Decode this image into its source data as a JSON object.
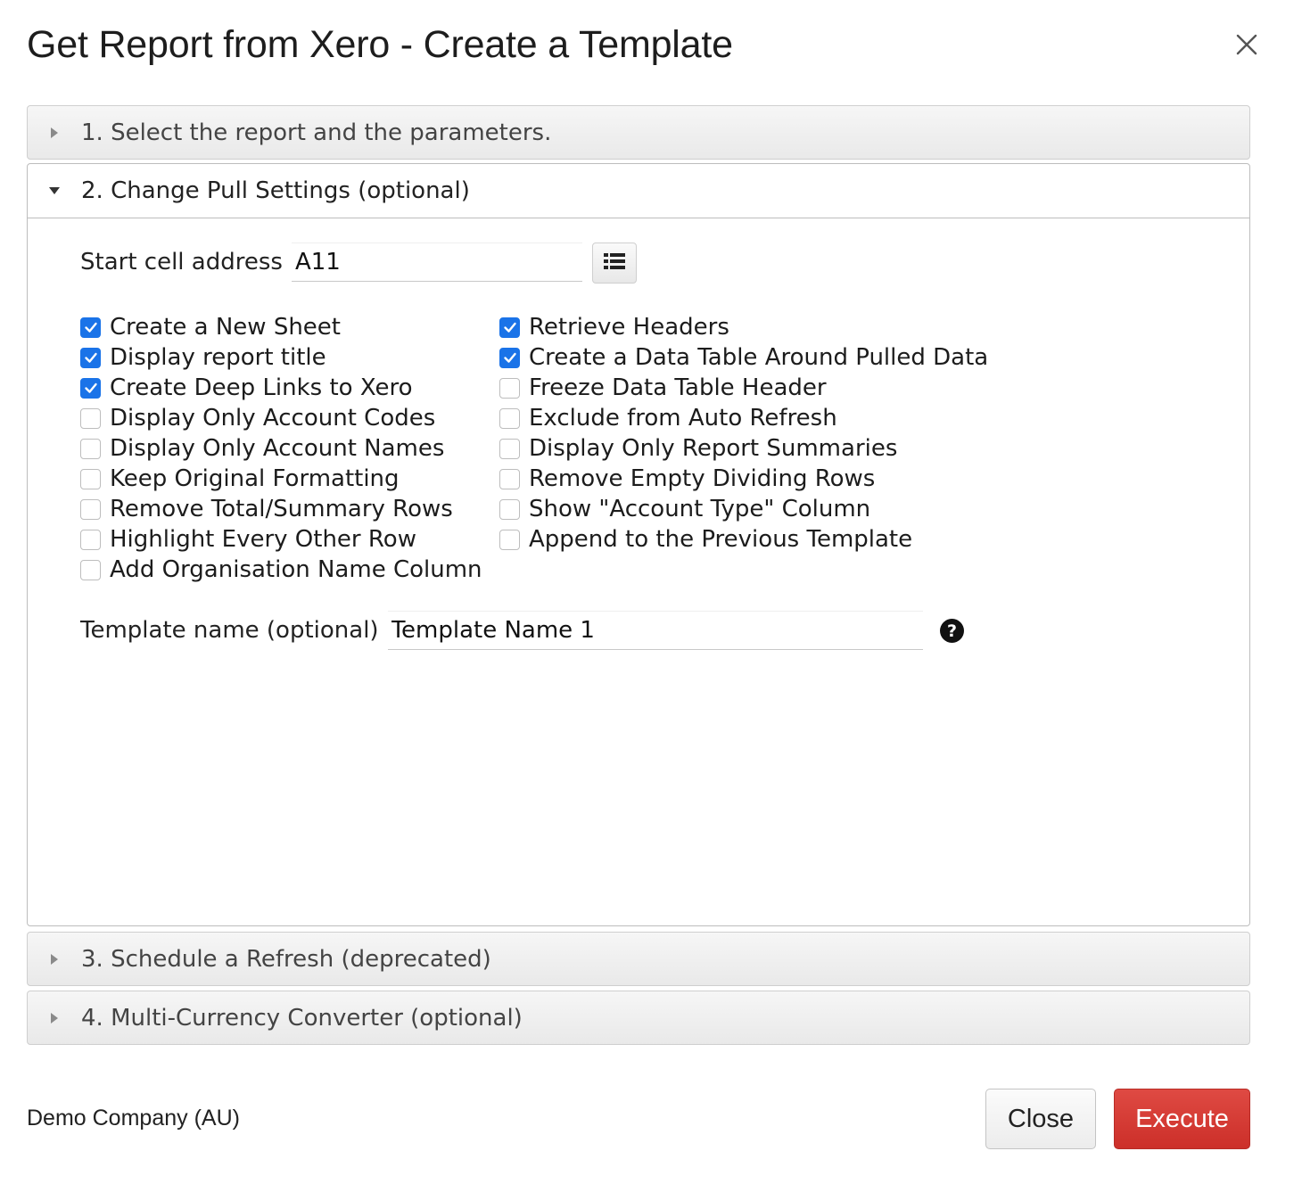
{
  "dialog": {
    "title": "Get Report from Xero - Create a Template",
    "close_icon": "close-icon"
  },
  "sections": [
    {
      "label": "1. Select the report and the parameters.",
      "expanded": false
    },
    {
      "label": "2. Change Pull Settings (optional)",
      "expanded": true
    },
    {
      "label": "3. Schedule a Refresh (deprecated)",
      "expanded": false
    },
    {
      "label": "4. Multi-Currency Converter (optional)",
      "expanded": false
    }
  ],
  "pull_settings": {
    "start_cell_label": "Start cell address",
    "start_cell_value": "A11",
    "cell_picker_icon": "list-icon",
    "options_left": [
      {
        "label": "Create a New Sheet",
        "checked": true
      },
      {
        "label": "Display report title",
        "checked": true
      },
      {
        "label": "Create Deep Links to Xero",
        "checked": true
      },
      {
        "label": "Display Only Account Codes",
        "checked": false
      },
      {
        "label": "Display Only Account Names",
        "checked": false
      },
      {
        "label": "Keep Original Formatting",
        "checked": false
      },
      {
        "label": "Remove Total/Summary Rows",
        "checked": false
      },
      {
        "label": "Highlight Every Other Row",
        "checked": false
      },
      {
        "label": "Add Organisation Name Column",
        "checked": false
      }
    ],
    "options_right": [
      {
        "label": "Retrieve Headers",
        "checked": true
      },
      {
        "label": "Create a Data Table Around Pulled Data",
        "checked": true
      },
      {
        "label": "Freeze Data Table Header",
        "checked": false
      },
      {
        "label": "Exclude from Auto Refresh",
        "checked": false
      },
      {
        "label": "Display Only Report Summaries",
        "checked": false
      },
      {
        "label": "Remove Empty Dividing Rows",
        "checked": false
      },
      {
        "label": "Show \"Account Type\" Column",
        "checked": false
      },
      {
        "label": "Append to the Previous Template",
        "checked": false
      }
    ],
    "template_name_label": "Template name (optional)",
    "template_name_value": "Template Name 1",
    "help_glyph": "?"
  },
  "footer": {
    "company": "Demo Company (AU)",
    "close_label": "Close",
    "execute_label": "Execute"
  },
  "colors": {
    "checkbox_checked": "#1a73e8",
    "execute_button": "#d33b35"
  }
}
